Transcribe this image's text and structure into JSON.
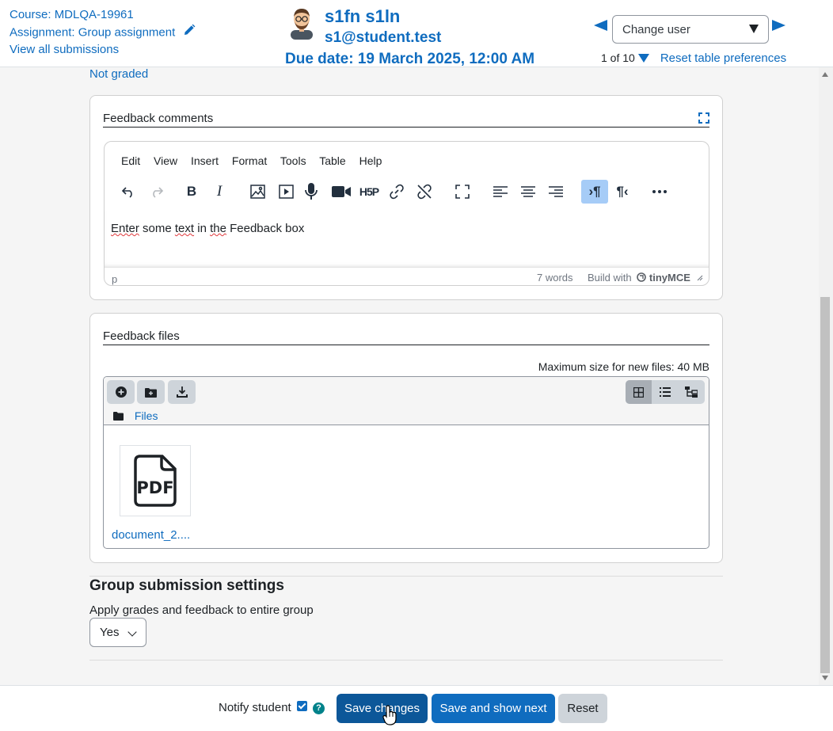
{
  "header": {
    "course": "Course: MDLQA-19961",
    "assignment": "Assignment: Group assignment",
    "view_all": "View all submissions",
    "user_name": "s1fn s1ln",
    "user_email": "s1@student.test",
    "due_date": "Due date: 19 March 2025, 12:00 AM",
    "change_user": "Change user",
    "pager": "1 of 10",
    "reset_prefs": "Reset table preferences"
  },
  "grade": {
    "status": "Not graded"
  },
  "feedback_comments": {
    "title": "Feedback comments",
    "menu": [
      "Edit",
      "View",
      "Insert",
      "Format",
      "Tools",
      "Table",
      "Help"
    ],
    "toolbar_icons": [
      "undo-icon",
      "redo-icon",
      "bold-icon",
      "italic-icon",
      "image-icon",
      "media-icon",
      "record-audio-icon",
      "record-video-icon",
      "h5p-icon",
      "link-icon",
      "unlink-icon",
      "fullscreen-icon",
      "align-left-icon",
      "align-center-icon",
      "align-right-icon",
      "ltr-icon",
      "rtl-icon",
      "more-icon"
    ],
    "content_parts": [
      "Enter",
      " some ",
      "text",
      " in ",
      "the",
      " Feedback box"
    ],
    "status_path": "p",
    "word_count": "7 words",
    "build_with": "Build with",
    "brand": "tinyMCE"
  },
  "feedback_files": {
    "title": "Feedback files",
    "max_size": "Maximum size for new files: 40 MB",
    "path_label": "Files",
    "file_type": "PDF",
    "file_name": "document_2...."
  },
  "group_settings": {
    "heading": "Group submission settings",
    "label": "Apply grades and feedback to entire group",
    "value": "Yes"
  },
  "footer": {
    "notify_label": "Notify student",
    "notify_checked": true,
    "save_label": "Save changes",
    "save_next_label": "Save and show next",
    "reset_label": "Reset"
  },
  "colors": {
    "link": "#0f6cbf",
    "primary": "#0f6cbf",
    "secondary": "#ced4da",
    "help": "#00828a",
    "active_tool": "#a6ccf7"
  }
}
